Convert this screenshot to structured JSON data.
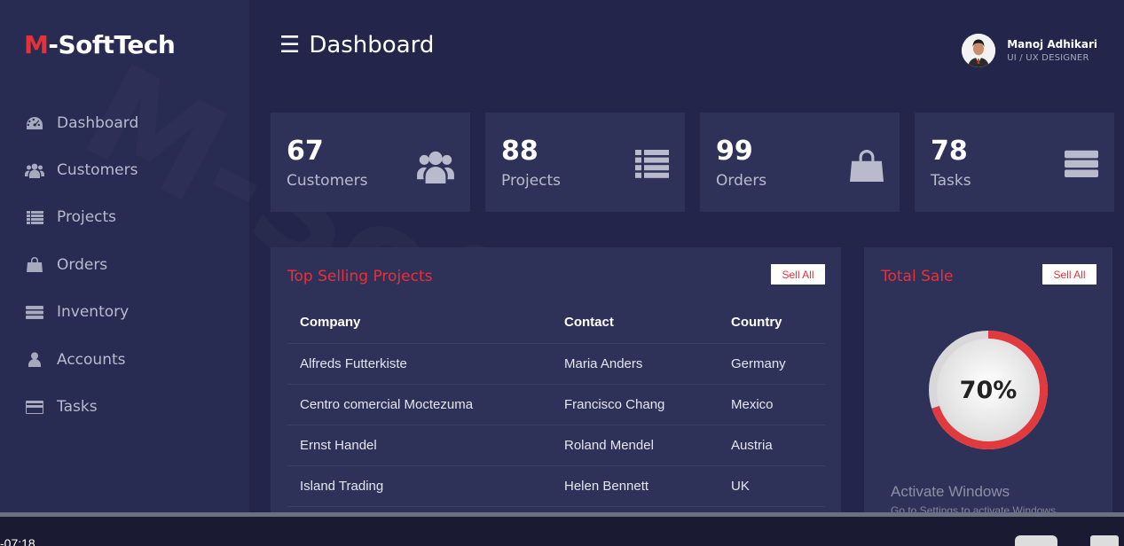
{
  "brand": {
    "prefix": "M",
    "rest": "-SoftTech"
  },
  "watermark": "M-SoftTech",
  "sidebar": {
    "items": [
      {
        "label": "Dashboard",
        "icon": "tachometer-icon"
      },
      {
        "label": "Customers",
        "icon": "users-icon"
      },
      {
        "label": "Projects",
        "icon": "list-icon"
      },
      {
        "label": "Orders",
        "icon": "shopping-bag-icon"
      },
      {
        "label": "Inventory",
        "icon": "server-icon"
      },
      {
        "label": "Accounts",
        "icon": "user-icon"
      },
      {
        "label": "Tasks",
        "icon": "credit-card-icon"
      }
    ]
  },
  "header": {
    "menu_glyph": "☰",
    "title": "Dashboard"
  },
  "user": {
    "name": "Manoj Adhikari",
    "role": "UI / UX DESIGNER"
  },
  "cards": [
    {
      "value": "67",
      "label": "Customers",
      "icon": "users-icon"
    },
    {
      "value": "88",
      "label": "Projects",
      "icon": "list-icon"
    },
    {
      "value": "99",
      "label": "Orders",
      "icon": "shopping-bag-icon"
    },
    {
      "value": "78",
      "label": "Tasks",
      "icon": "server-icon"
    }
  ],
  "top_selling": {
    "title": "Top Selling Projects",
    "button": "Sell All",
    "columns": [
      "Company",
      "Contact",
      "Country"
    ],
    "rows": [
      [
        "Alfreds Futterkiste",
        "Maria Anders",
        "Germany"
      ],
      [
        "Centro comercial Moctezuma",
        "Francisco Chang",
        "Mexico"
      ],
      [
        "Ernst Handel",
        "Roland Mendel",
        "Austria"
      ],
      [
        "Island Trading",
        "Helen Bennett",
        "UK"
      ]
    ]
  },
  "total_sale": {
    "title": "Total Sale",
    "button": "Sell All",
    "percent_label": "70%",
    "percent": 0.7
  },
  "windows_notice": {
    "title": "Activate Windows",
    "subtitle": "Go to Settings to activate Windows."
  },
  "video": {
    "time": "-07:18",
    "progress": 0.0
  },
  "colors": {
    "accent": "#e8303a",
    "background": "#23264a",
    "sidebar": "#282b52",
    "card": "#2e3258"
  }
}
